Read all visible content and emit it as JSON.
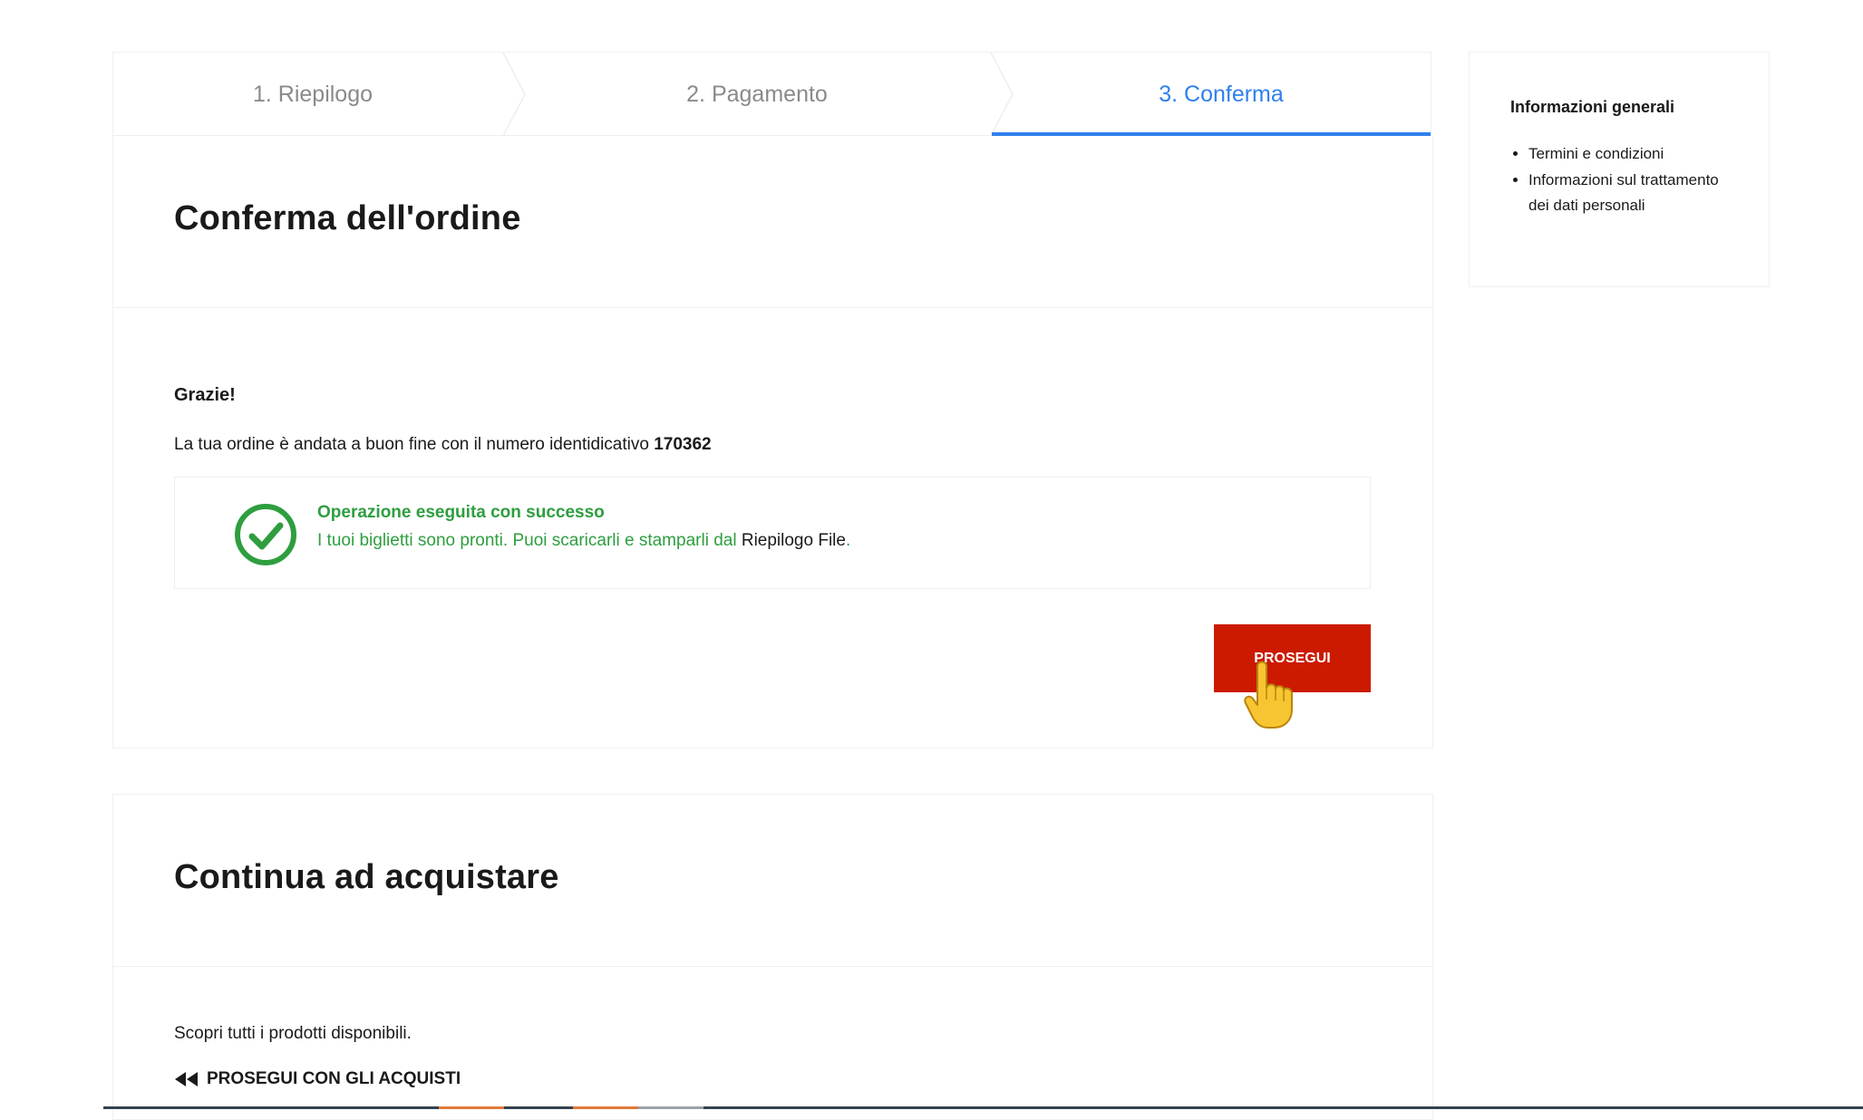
{
  "steps": [
    {
      "label": "1. Riepilogo"
    },
    {
      "label": "2. Pagamento"
    },
    {
      "label": "3. Conferma"
    }
  ],
  "confirm": {
    "title": "Conferma dell'ordine",
    "thanks": "Grazie!",
    "order_text": "La tua ordine è andata a buon fine con il numero identidicativo",
    "order_number": "170362",
    "success_title": "Operazione eseguita con successo",
    "success_text": "I tuoi biglietti sono pronti. Puoi scaricarli e stamparli dal",
    "success_link": "Riepilogo File",
    "success_end": ".",
    "button_label": "PROSEGUI"
  },
  "continue": {
    "title": "Continua ad acquistare",
    "text": "Scopri tutti i prodotti disponibili.",
    "link_label": "PROSEGUI CON GLI ACQUISTI"
  },
  "sidebar": {
    "title": "Informazioni generali",
    "items": [
      {
        "label": "Termini e condizioni"
      },
      {
        "label": "Informazioni sul trattamento dei dati personali"
      }
    ]
  },
  "colors": {
    "active_step": "#2f80ed",
    "success": "#2e9e3f",
    "button": "#cc1a00"
  }
}
